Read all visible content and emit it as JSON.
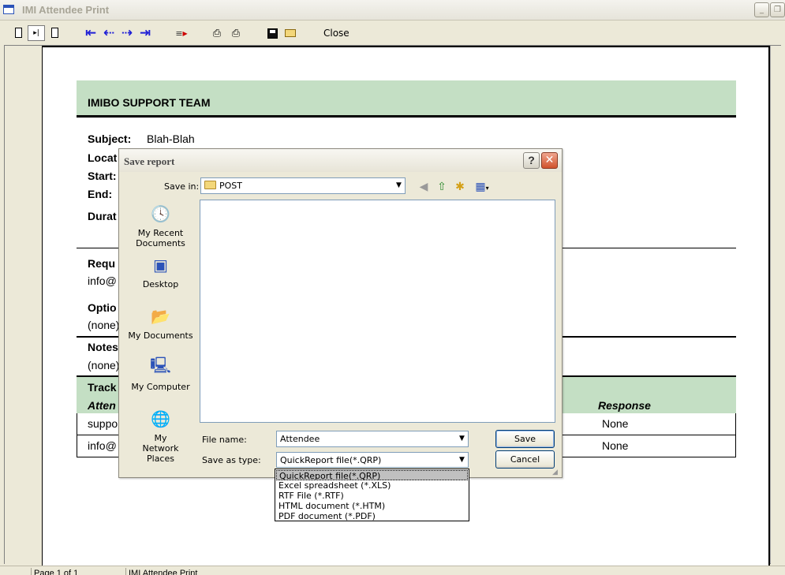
{
  "window": {
    "title": "IMI Attendee Print",
    "minimize_glyph": "_",
    "restore_glyph": "❐"
  },
  "toolbar": {
    "first_page": "⇤",
    "prev_page": "⇠",
    "next_page": "⇢",
    "last_page": "⇥",
    "close_label": "Close"
  },
  "report": {
    "team": "IMIBO SUPPORT TEAM",
    "subject_label": "Subject:",
    "subject_value": "Blah-Blah",
    "location_label": "Locat",
    "start_label": "Start:",
    "end_label": "End:",
    "duration_label": "Durat",
    "required_label": "Requ",
    "required_value": "info@",
    "optional_label": "Optio",
    "optional_value": "(none)",
    "notes_label": "Notes",
    "notes_value": "(none)",
    "tracking_label": "Track",
    "attendee_header": "Atten",
    "response_header": "Response",
    "rows": [
      {
        "attendee": "suppo",
        "response": "None"
      },
      {
        "attendee": "info@",
        "response": "None"
      }
    ]
  },
  "statusbar": {
    "page_info": "Page 1 of 1",
    "doc_title": "IMI Attendee Print"
  },
  "dialog": {
    "title": "Save report",
    "help_glyph": "?",
    "close_glyph": "✕",
    "save_in_label": "Save in:",
    "save_in_value": "POST",
    "places": [
      {
        "label": "My Recent Documents"
      },
      {
        "label": "Desktop"
      },
      {
        "label": "My Documents"
      },
      {
        "label": "My Computer"
      },
      {
        "label": "My Network Places"
      }
    ],
    "file_name_label": "File name:",
    "file_name_value": "Attendee",
    "save_type_label": "Save as type:",
    "save_type_value": "QuickReport file(*.QRP)",
    "save_button": "Save",
    "cancel_button": "Cancel",
    "type_options": [
      "QuickReport file(*.QRP)",
      "Excel spreadsheet (*.XLS)",
      "RTF File (*.RTF)",
      "HTML document (*.HTM)",
      "PDF document (*.PDF)"
    ]
  }
}
